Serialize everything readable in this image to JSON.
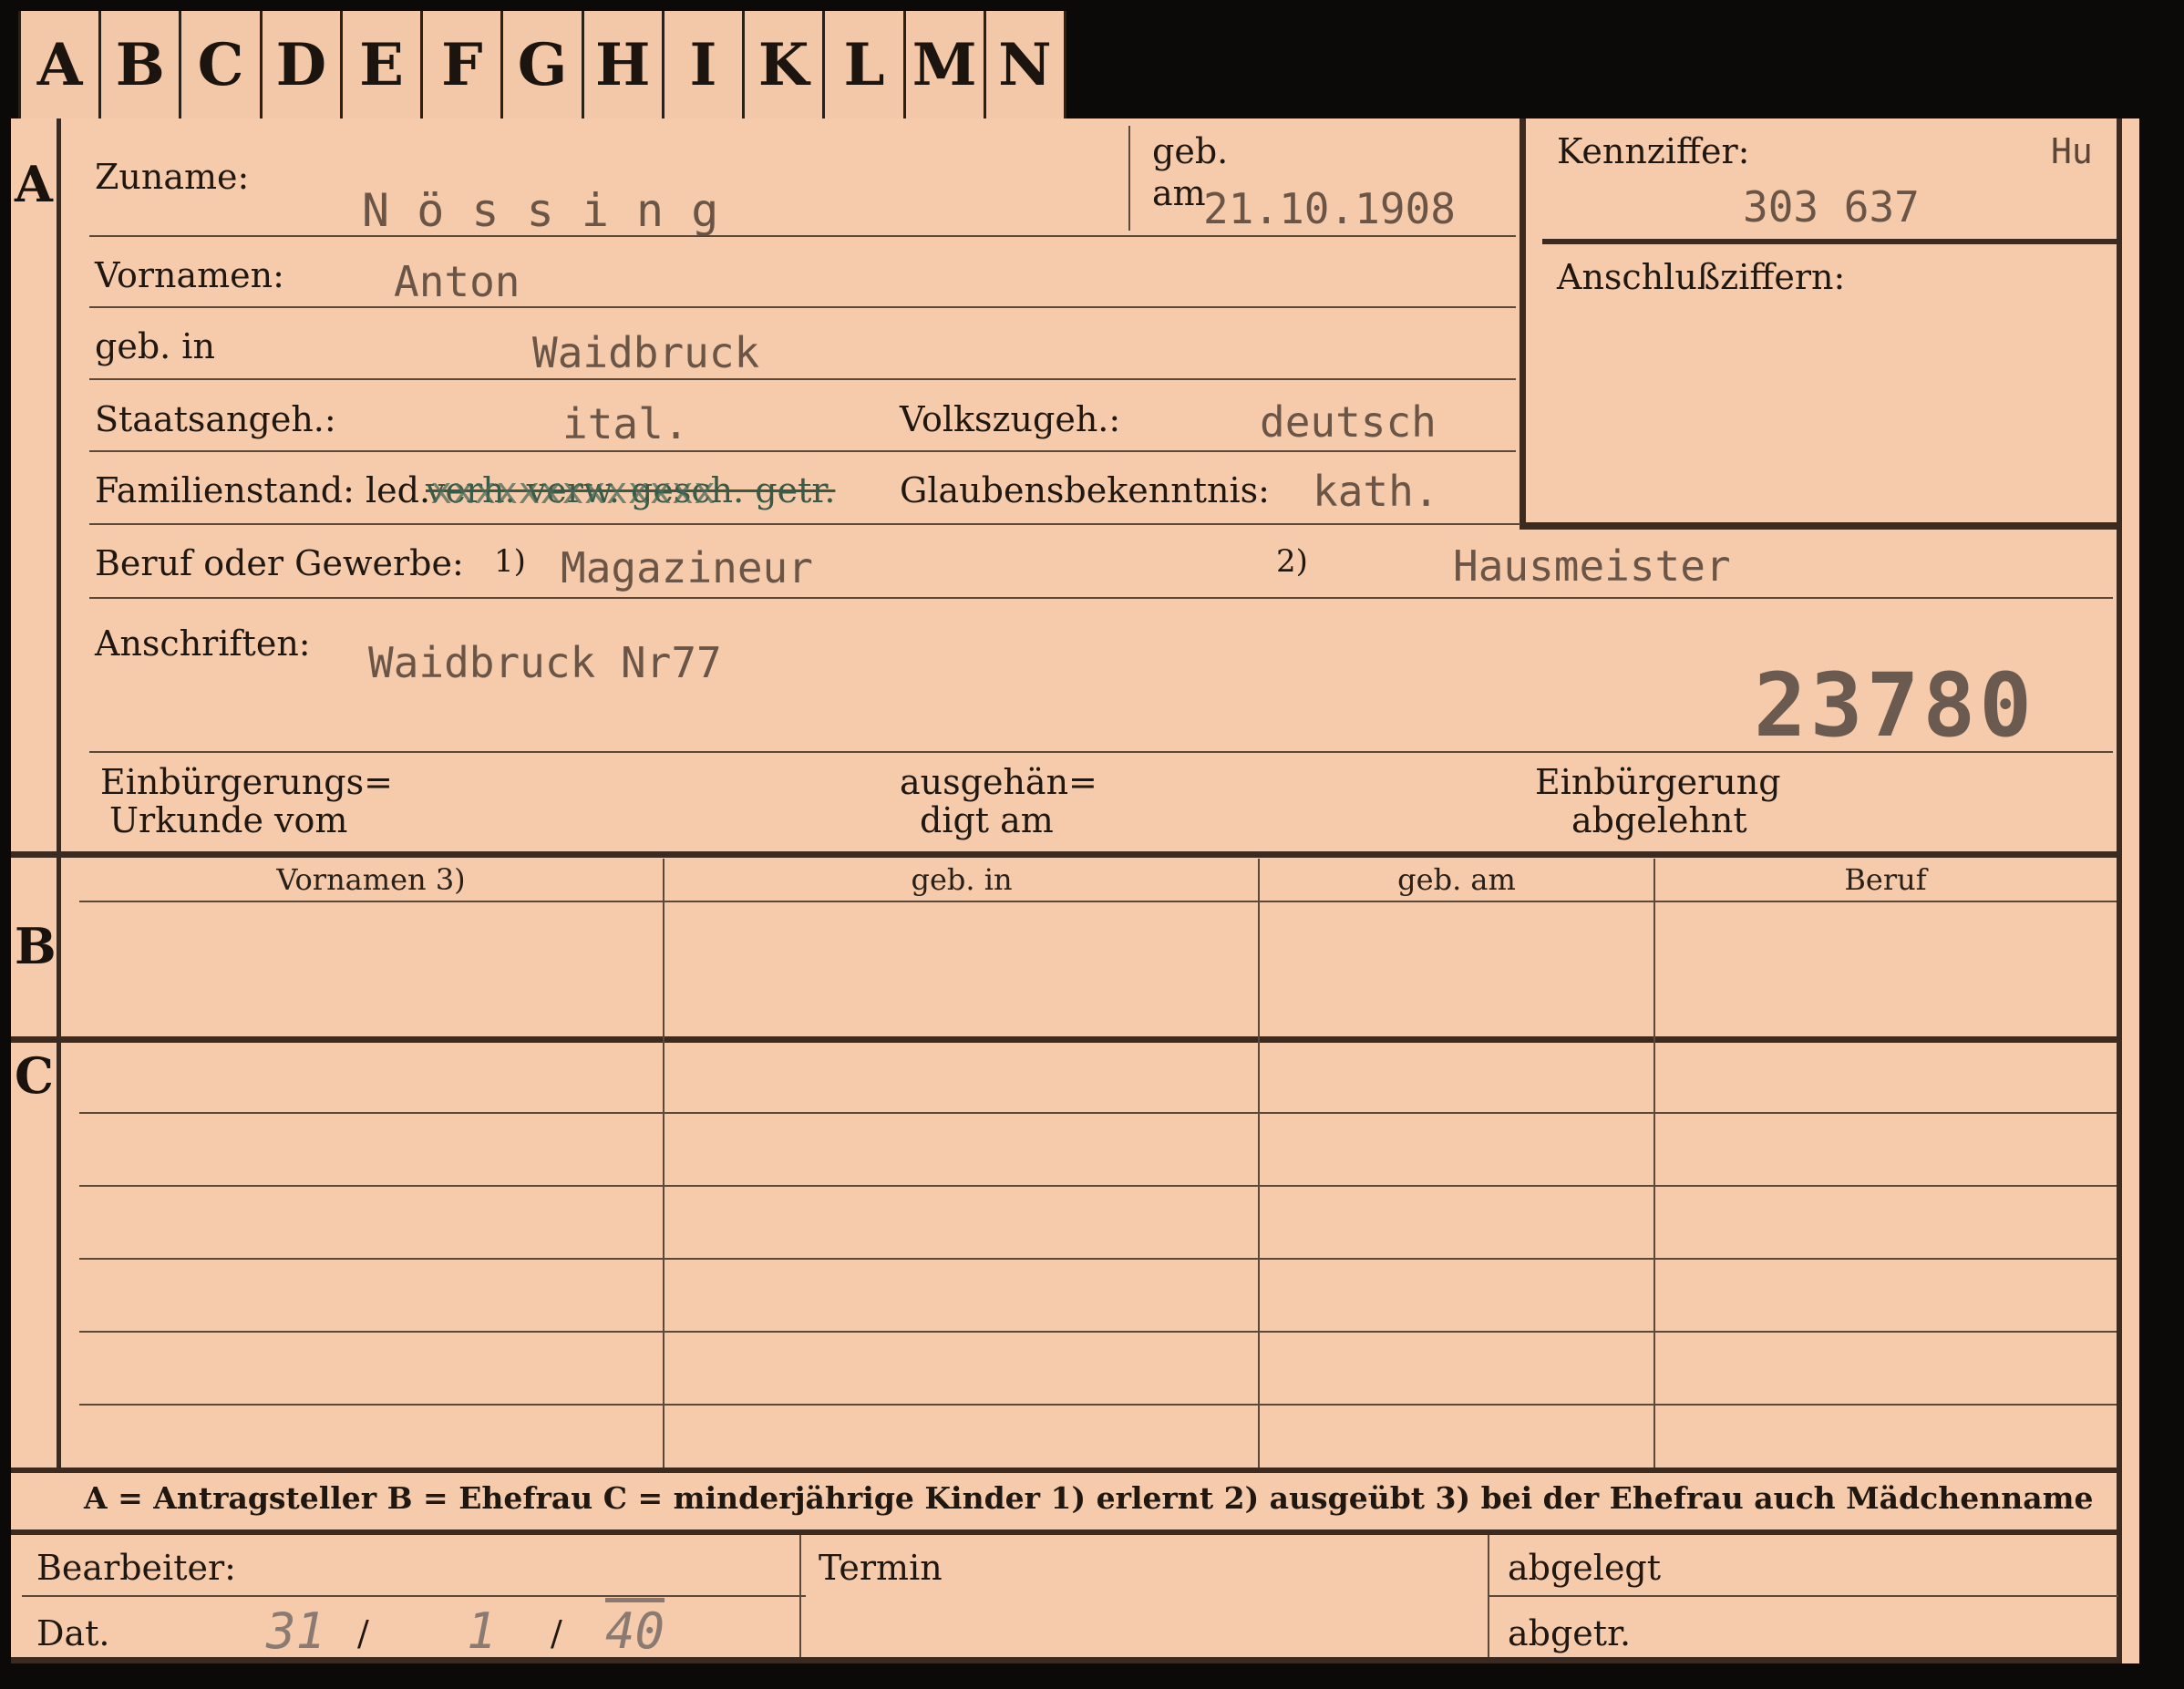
{
  "tabs": [
    "A",
    "B",
    "C",
    "D",
    "E",
    "F",
    "G",
    "H",
    "I",
    "K",
    "L",
    "M",
    "N"
  ],
  "section_a": {
    "marker": "A",
    "zuname_label": "Zuname:",
    "zuname_value": "N ö s s i n g",
    "geb_am_label_1": "geb.",
    "geb_am_label_2": "am",
    "geb_am_value": "21.10.1908",
    "vornamen_label": "Vornamen:",
    "vornamen_value": "Anton",
    "geb_in_label": "geb. in",
    "geb_in_value": "Waidbruck",
    "staatsangeh_label": "Staatsangeh.:",
    "staatsangeh_value": "ital.",
    "volkszugeh_label": "Volkszugeh.:",
    "volkszugeh_value": "deutsch",
    "familienstand_label": "Familienstand: led.",
    "familienstand_struck": "verh. verw. gesch. getr.",
    "familienstand_overtype": "xxxxxxxxxxxxx",
    "glaubens_label": "Glaubensbekenntnis:",
    "glaubens_value": "kath.",
    "beruf_label": "Beruf oder Gewerbe:",
    "beruf_fn1": "1)",
    "beruf_value_1": "Magazineur",
    "beruf_fn2": "2)",
    "beruf_value_2": "Hausmeister",
    "anschriften_label": "Anschriften:",
    "anschriften_value": "Waidbruck Nr77",
    "stamp_number": "23780",
    "einb_urkunde_label_1": "Einbürgerungs=",
    "einb_urkunde_label_2": "Urkunde vom",
    "ausgehaendigt_label_1": "ausgehän=",
    "ausgehaendigt_label_2": "digt am",
    "einb_abgelehnt_label_1": "Einbürgerung",
    "einb_abgelehnt_label_2": "abgelehnt"
  },
  "kennziffer": {
    "label": "Kennziffer:",
    "suffix": "Hu",
    "value": "303 637",
    "anschluss_label": "Anschlußziffern:"
  },
  "section_b": {
    "marker": "B",
    "columns": [
      "Vornamen 3)",
      "geb. in",
      "geb. am",
      "Beruf"
    ]
  },
  "section_c": {
    "marker": "C"
  },
  "legend": "A = Antragsteller   B = Ehefrau   C = minderjährige Kinder   1) erlernt   2) ausgeübt   3) bei der Ehefrau auch Mädchenname",
  "footer": {
    "bearbeiter_label": "Bearbeiter:",
    "dat_label": "Dat.",
    "dat_day": "31",
    "dat_month": "1",
    "dat_year": "40",
    "dat_sep": "/",
    "termin_label": "Termin",
    "abgelegt_label": "abgelegt",
    "abgetr_label": "abgetr."
  }
}
